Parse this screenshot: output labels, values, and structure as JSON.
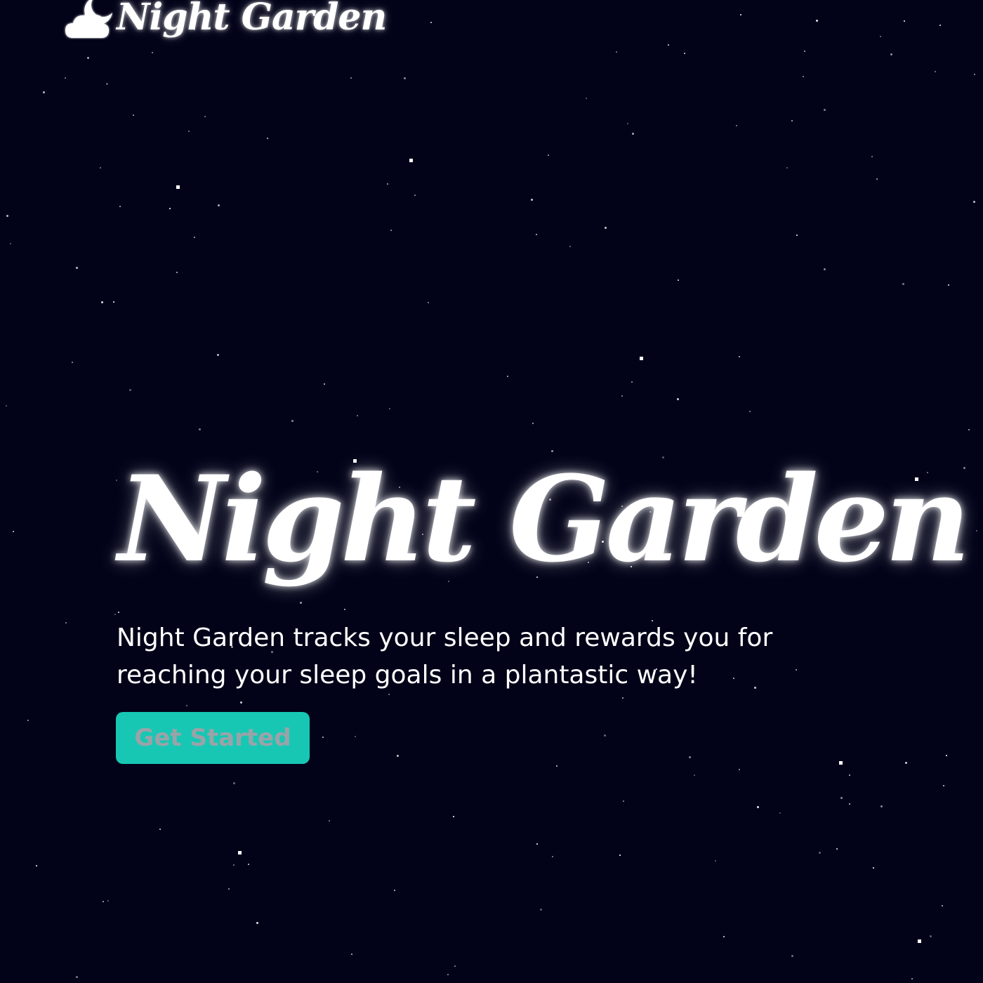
{
  "header": {
    "logo_icon": "moon-cloud-icon",
    "brand": "Night Garden"
  },
  "hero": {
    "title": "Night Garden",
    "description": "Night Garden tracks your sleep and rewards you for reaching your sleep goals in a plantastic way!",
    "cta_label": "Get Started"
  },
  "colors": {
    "background": "#020318",
    "accent": "#17c7b4",
    "cta_text": "#9aa3a8",
    "text": "#ffffff"
  }
}
